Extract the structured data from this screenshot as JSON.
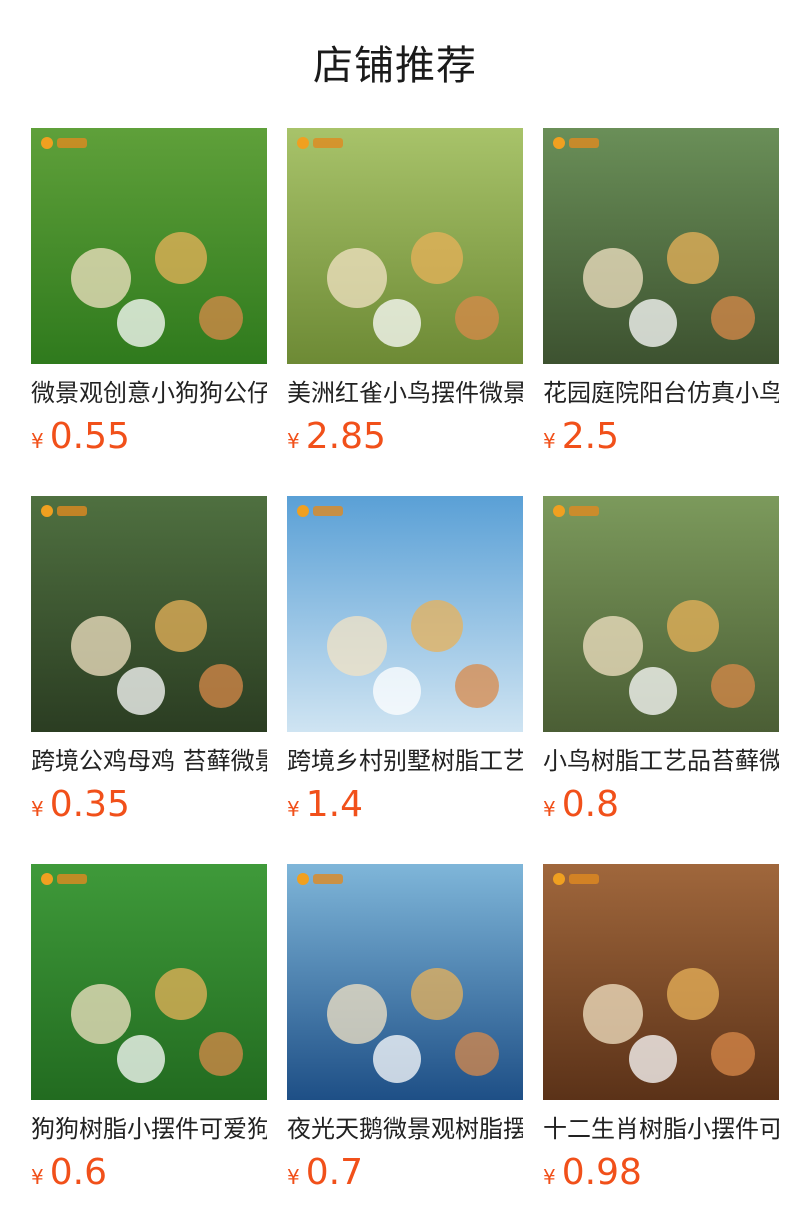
{
  "page": {
    "title": "店铺推荐"
  },
  "currency": "¥",
  "products": [
    {
      "name": "微景观创意小狗狗公仔",
      "price": "0.55",
      "image": "puppies-figurines-on-grass",
      "bg": [
        "#5fa03a",
        "#2f7a1d"
      ]
    },
    {
      "name": "美洲红雀小鸟摆件微景观",
      "price": "2.85",
      "image": "red-cardinal-birds-on-moss",
      "bg": [
        "#a8c36a",
        "#6d8a35"
      ]
    },
    {
      "name": "花园庭院阳台仿真小鸟",
      "price": "2.5",
      "image": "garden-birds-on-branch",
      "bg": [
        "#6a8f58",
        "#3d5230"
      ]
    },
    {
      "name": "跨境公鸡母鸡 苔藓微景观",
      "price": "0.35",
      "image": "rooster-hen-chicks-figurines",
      "bg": [
        "#4f7040",
        "#2b3d22"
      ]
    },
    {
      "name": "跨境乡村别墅树脂工艺品",
      "price": "1.4",
      "image": "village-cottage-figurines",
      "bg": [
        "#5aa0d6",
        "#cfe4f2"
      ]
    },
    {
      "name": "小鸟树脂工艺品苔藓微景观",
      "price": "0.8",
      "image": "songbird-figurines-on-log",
      "bg": [
        "#7c9a5c",
        "#4b5e35"
      ]
    },
    {
      "name": "狗狗树脂小摆件可爱狗狗",
      "price": "0.6",
      "image": "puppy-figurines-lying",
      "bg": [
        "#3f9a3a",
        "#226b20"
      ]
    },
    {
      "name": "夜光天鹅微景观树脂摆件",
      "price": "0.7",
      "image": "glow-swan-figurines",
      "bg": [
        "#7fb6d9",
        "#1e4f86"
      ]
    },
    {
      "name": "十二生肖树脂小摆件可爱",
      "price": "0.98",
      "image": "zodiac-animal-figurines",
      "bg": [
        "#a0673c",
        "#5b3218"
      ]
    }
  ]
}
